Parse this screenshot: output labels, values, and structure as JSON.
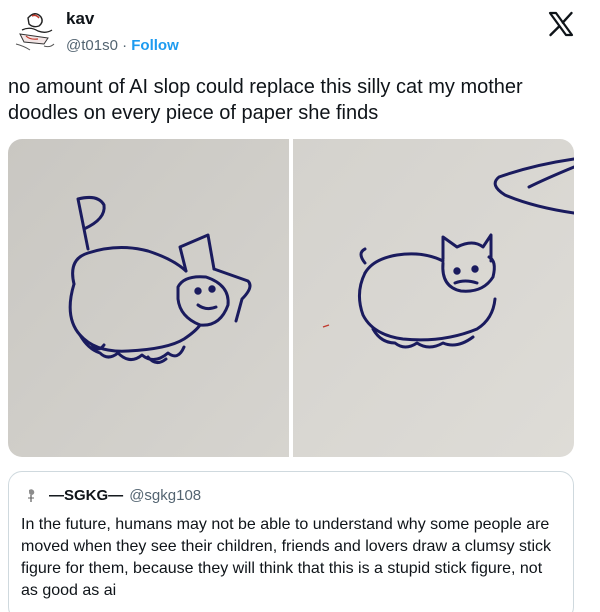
{
  "author": {
    "name": "kav",
    "handle": "@t01s0",
    "separator": " · ",
    "follow_label": "Follow"
  },
  "tweet": {
    "text": "no amount of AI slop could replace this silly cat my mother doodles on every piece of paper she finds"
  },
  "media": [
    {
      "icon": "cat-doodle-left-photo"
    },
    {
      "icon": "cat-doodle-right-photo"
    }
  ],
  "quote": {
    "name": "—SGKG—",
    "handle": "@sgkg108",
    "text": "In the future, humans may not be able to understand why some people are moved when they see their children, friends and lovers draw a clumsy stick figure for them, because they will think that this is a stupid stick figure, not as good as ai"
  },
  "colors": {
    "link": "#1d9bf0",
    "muted": "#536471",
    "ink": "#1a1b5e",
    "paper": "#cfcdc9"
  }
}
